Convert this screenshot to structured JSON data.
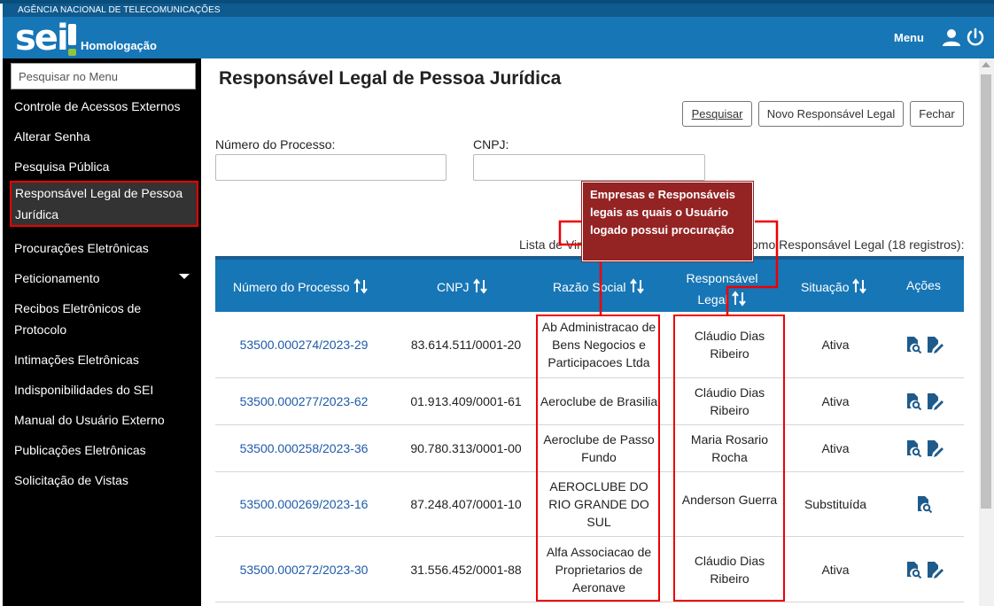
{
  "header": {
    "agency": "AGÊNCIA NACIONAL DE TELECOMUNICAÇÕES",
    "logo_text": "sei",
    "environment": "Homologação",
    "menu_label": "Menu",
    "colors": {
      "brand_blue": "#1776b6",
      "accent_green": "#8dc63f"
    }
  },
  "sidebar": {
    "search_placeholder": "Pesquisar no Menu",
    "items": [
      {
        "label": "Controle de Acessos Externos"
      },
      {
        "label": "Alterar Senha"
      },
      {
        "label": "Pesquisa Pública"
      },
      {
        "label": "Responsável Legal de Pessoa Jurídica",
        "active": true
      },
      {
        "label": "Procurações Eletrônicas"
      },
      {
        "label": "Peticionamento"
      },
      {
        "label": "Recibos Eletrônicos de Protocolo"
      },
      {
        "label": "Intimações Eletrônicas"
      },
      {
        "label": "Indisponibilidades do SEI"
      },
      {
        "label": "Manual do Usuário Externo"
      },
      {
        "label": "Publicações Eletrônicas"
      },
      {
        "label": "Solicitação de Vistas"
      }
    ]
  },
  "main": {
    "title": "Responsável Legal de Pessoa Jurídica",
    "buttons": {
      "search": "Pesquisar",
      "new": "Novo Responsável Legal",
      "close": "Fechar"
    },
    "filters": {
      "process_label": "Número do Processo:",
      "process_value": "",
      "cnpj_label": "CNPJ:",
      "cnpj_value": ""
    },
    "list_caption_left": "Lista de Vin",
    "list_caption_right": "omo Responsável Legal (18 registros):",
    "table": {
      "headers": [
        "Número do Processo",
        "CNPJ",
        "Razão Social",
        "Responsável Legal",
        "Situação",
        "Ações"
      ],
      "rows": [
        {
          "process": "53500.000274/2023-29",
          "cnpj": "83.614.511/0001-20",
          "name": "Ab Administracao de Bens Negocios e Participacoes Ltda",
          "legal": "Cláudio Dias Ribeiro",
          "status": "Ativa",
          "actions": [
            "view-icon",
            "edit-icon"
          ]
        },
        {
          "process": "53500.000277/2023-62",
          "cnpj": "01.913.409/0001-61",
          "name": "Aeroclube de Brasilia",
          "legal": "Cláudio Dias Ribeiro",
          "status": "Ativa",
          "actions": [
            "view-icon",
            "edit-icon"
          ]
        },
        {
          "process": "53500.000258/2023-36",
          "cnpj": "90.780.313/0001-00",
          "name": "Aeroclube de Passo Fundo",
          "legal": "Maria Rosario Rocha",
          "status": "Ativa",
          "actions": [
            "view-icon",
            "edit-icon"
          ]
        },
        {
          "process": "53500.000269/2023-16",
          "cnpj": "87.248.407/0001-10",
          "name": "AEROCLUBE DO RIO GRANDE DO SUL",
          "legal": "Anderson Guerra",
          "status": "Substituída",
          "actions": [
            "view-icon"
          ]
        },
        {
          "process": "53500.000272/2023-30",
          "cnpj": "31.556.452/0001-88",
          "name": "Alfa Associacao de Proprietarios de Aeronave",
          "legal": "Cláudio Dias Ribeiro",
          "status": "Ativa",
          "actions": [
            "view-icon",
            "edit-icon"
          ]
        }
      ]
    }
  },
  "annotation": {
    "callout": "Empresas e Responsáveis legais as quais o Usuário logado possui procuração",
    "color": "#942323"
  }
}
